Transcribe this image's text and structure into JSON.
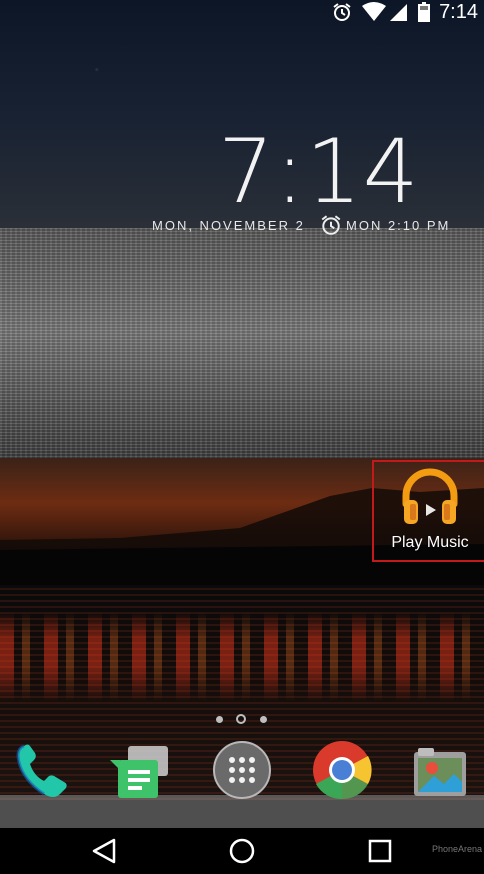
{
  "status_bar": {
    "time": "7:14",
    "icons": [
      "alarm-icon",
      "wifi-icon",
      "signal-icon",
      "battery-icon"
    ]
  },
  "lock_clock": {
    "time": "7:14",
    "date": "MON, NOVEMBER 2",
    "alarm": "MON 2:10 PM"
  },
  "shortcut": {
    "label": "Play Music",
    "icon": "headphones-icon",
    "accent": "#f39c12"
  },
  "dock": {
    "apps": [
      "phone-icon",
      "messenger-icon",
      "app-drawer-icon",
      "chrome-icon",
      "photos-icon"
    ]
  },
  "page_indicator": {
    "count": 3,
    "active": 2
  },
  "navigation": {
    "buttons": [
      "back-icon",
      "home-icon",
      "recents-icon"
    ]
  },
  "watermark": "PhoneArena",
  "colors": {
    "highlight_border": "#c21a1a",
    "phone_green": "#21c7a8",
    "messenger_green": "#3ec26a"
  }
}
